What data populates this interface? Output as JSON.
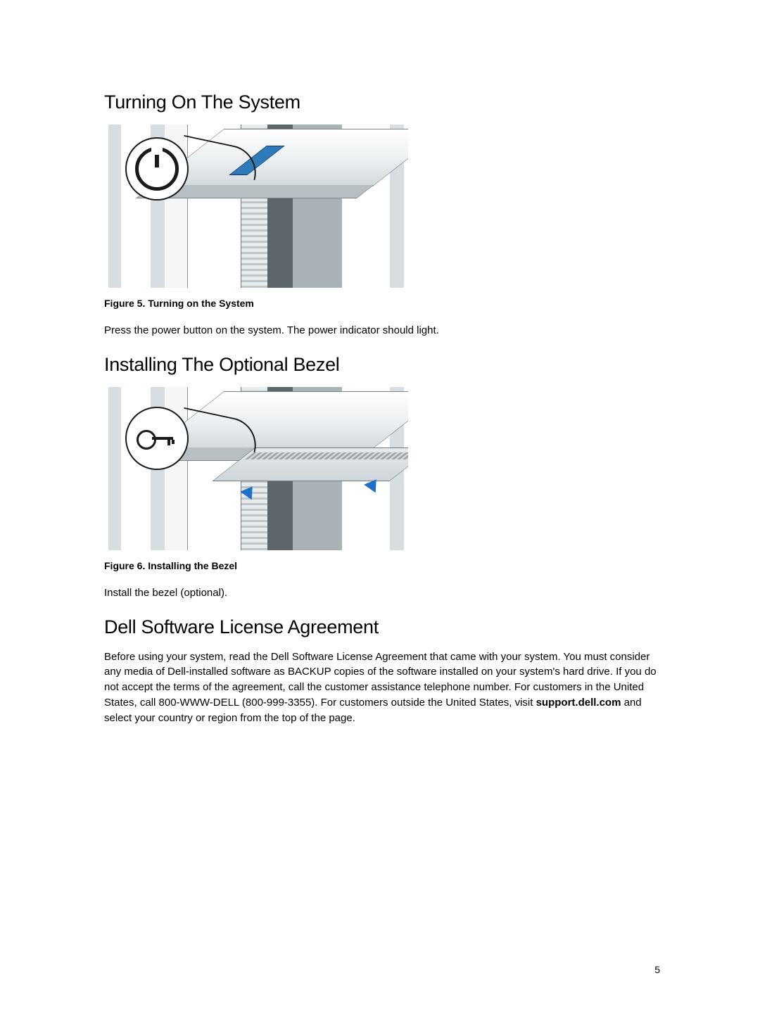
{
  "sections": {
    "turning_on": {
      "heading": "Turning On The System",
      "figure_caption": "Figure 5. Turning on the System",
      "body": "Press the power button on the system. The power indicator should light."
    },
    "bezel": {
      "heading": "Installing The Optional Bezel",
      "figure_caption": "Figure 6. Installing the Bezel",
      "body": "Install the bezel (optional)."
    },
    "license": {
      "heading": "Dell Software License Agreement",
      "body_pre": "Before using your system, read the Dell Software License Agreement that came with your system. You must consider any media of Dell-installed software as BACKUP copies of the software installed on your system's hard drive. If you do not accept the terms of the agreement, call the customer assistance telephone number. For customers in the United States, call 800-WWW-DELL (800-999-3355). For customers outside the United States, visit ",
      "support_link": "support.dell.com",
      "body_post": " and select your country or region from the top of the page."
    }
  },
  "page_number": "5"
}
